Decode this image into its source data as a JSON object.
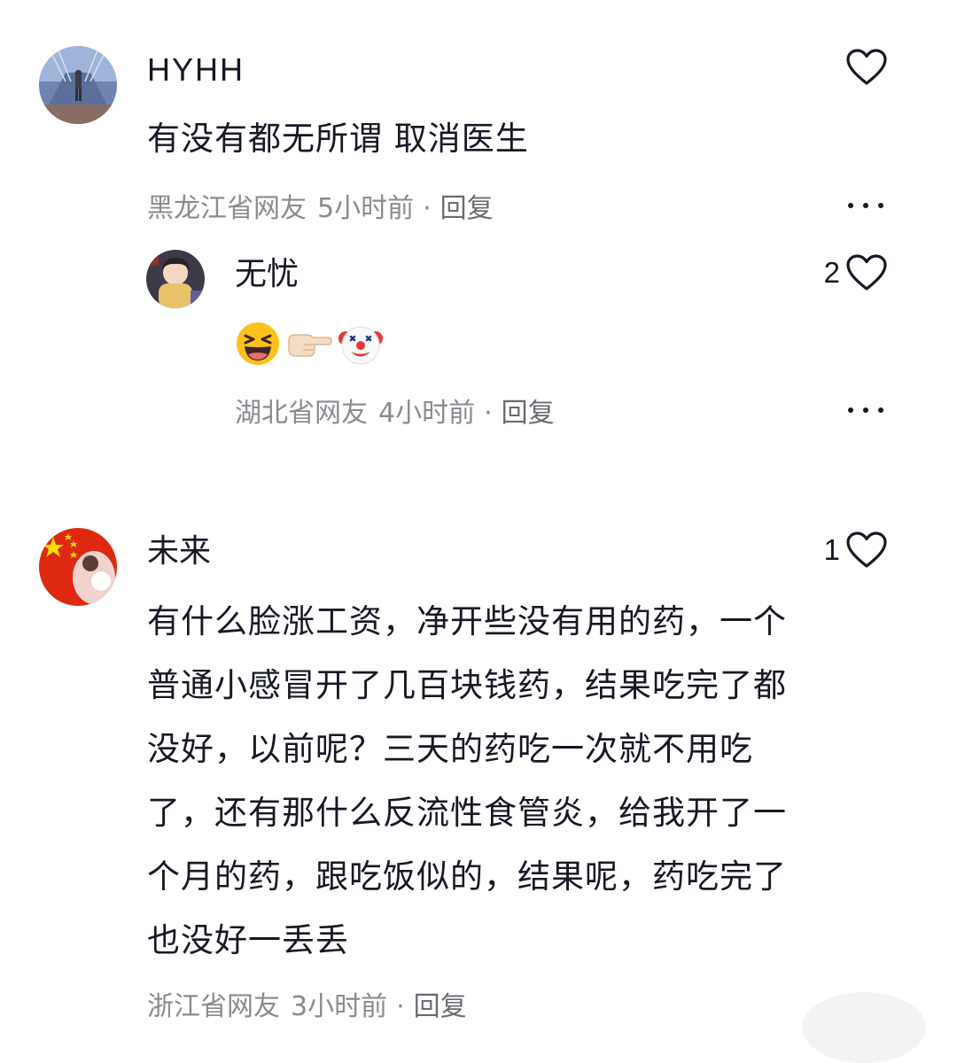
{
  "comments": [
    {
      "username": "HYHH",
      "content": "有没有都无所谓 取消医生",
      "location": "黑龙江省网友",
      "time": "5小时前",
      "separator": "·",
      "reply_label": "回复",
      "like_count": "",
      "avatar_icon": "avatar-stair-photo"
    },
    {
      "username": "无忧",
      "content_emojis": [
        "laughing-emoji",
        "pointing-right-hand-emoji",
        "clown-face-emoji"
      ],
      "location": "湖北省网友",
      "time": "4小时前",
      "separator": "·",
      "reply_label": "回复",
      "like_count": "2",
      "avatar_icon": "avatar-anime-photo"
    },
    {
      "username": "未来",
      "content_lines": [
        "有什么脸涨工资，净开些没有用的药，一个",
        "普通小感冒开了几百块钱药，结果吃完了都",
        "没好，以前呢？三天的药吃一次就不用吃",
        "了，还有那什么反流性食管炎，给我开了一",
        "个月的药，跟吃饭似的，结果呢，药吃完了",
        "也没好一丢丢"
      ],
      "location": "浙江省网友",
      "time": "3小时前",
      "separator": "·",
      "reply_label": "回复",
      "like_count": "1",
      "avatar_icon": "avatar-flag-photo"
    }
  ],
  "colors": {
    "text_primary": "#161823",
    "text_meta": "#8a8b91",
    "background": "#ffffff"
  },
  "icons": {
    "like": "heart-outline-icon",
    "more": "more-horizontal-icon"
  }
}
